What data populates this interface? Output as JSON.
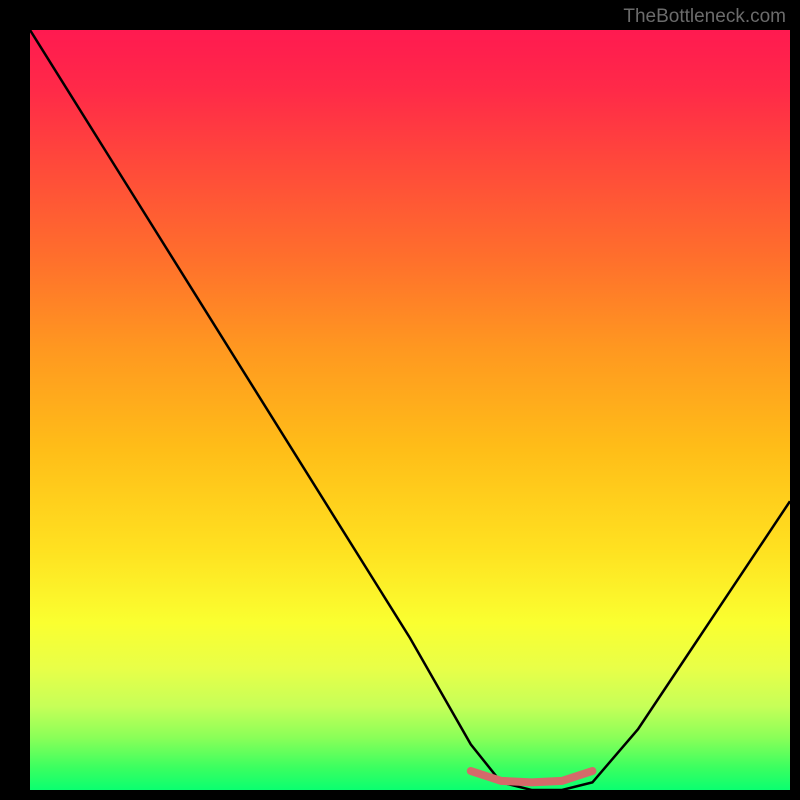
{
  "watermark": "TheBottleneck.com",
  "chart_data": {
    "type": "line",
    "title": "",
    "xlabel": "",
    "ylabel": "",
    "x_range": [
      0,
      100
    ],
    "y_range": [
      0,
      100
    ],
    "grid": false,
    "series": [
      {
        "name": "curve",
        "x": [
          0,
          10,
          20,
          30,
          40,
          50,
          58,
          62,
          66,
          70,
          74,
          80,
          88,
          96,
          100
        ],
        "y": [
          100,
          84,
          68,
          52,
          36,
          20,
          6,
          1,
          0,
          0,
          1,
          8,
          20,
          32,
          38
        ],
        "color": "#000000"
      },
      {
        "name": "bottom-highlight",
        "x": [
          58,
          62,
          66,
          70,
          74
        ],
        "y": [
          2.5,
          1.2,
          1.0,
          1.2,
          2.5
        ],
        "color": "#d46a6a"
      }
    ],
    "background_gradient": {
      "stops": [
        {
          "pos": 0.0,
          "color": "#ff1a50"
        },
        {
          "pos": 0.3,
          "color": "#ff6f2c"
        },
        {
          "pos": 0.55,
          "color": "#ffbd18"
        },
        {
          "pos": 0.78,
          "color": "#faff30"
        },
        {
          "pos": 0.93,
          "color": "#8cff58"
        },
        {
          "pos": 1.0,
          "color": "#0aff70"
        }
      ]
    }
  }
}
